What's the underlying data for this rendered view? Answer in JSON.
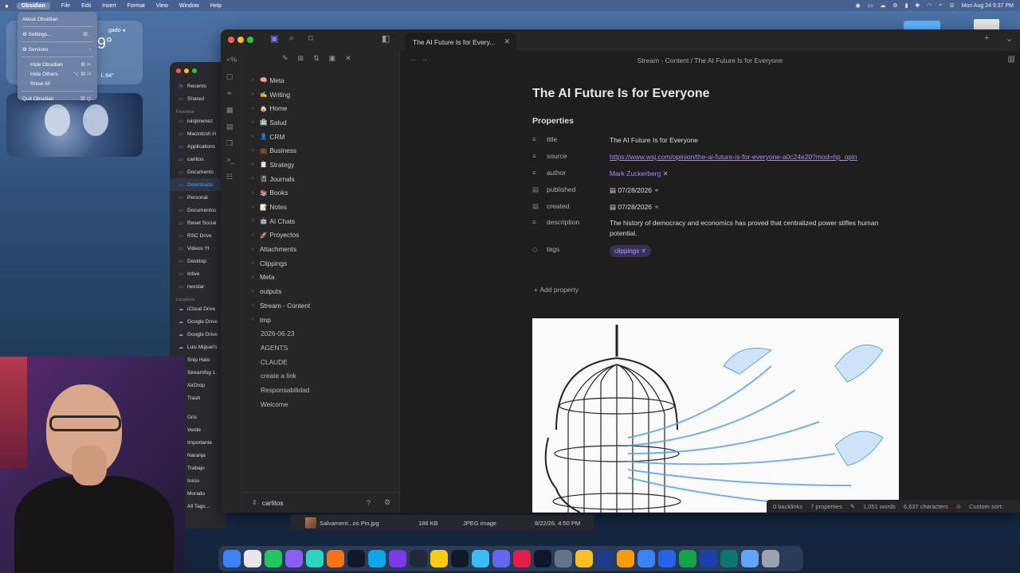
{
  "menubar": {
    "apple": "",
    "items": [
      "Obsidian",
      "File",
      "Edit",
      "Insert",
      "Format",
      "View",
      "Window",
      "Help"
    ],
    "clock": "Mon Aug 24  9:37 PM"
  },
  "app_menu": {
    "about": "About Obsidian",
    "settings": "Settings...",
    "settings_sc": "⌘ ,",
    "services": "Services",
    "hide": "Hide Obsidian",
    "hide_sc": "⌘ H",
    "hide_others": "Hide Others",
    "hide_others_sc": "⌥ ⌘ H",
    "show_all": "Show All",
    "quit": "Quit Obsidian",
    "quit_sc": "⌘ Q"
  },
  "weather": {
    "city": "gado ◂",
    "temp": "9°",
    "range": "L:64°",
    "row2": "y"
  },
  "finder": {
    "recents": "Recents",
    "shared": "Shared",
    "favorites_label": "Favorites",
    "favorites": [
      "luisjimenez",
      "Macintosh H",
      "Applications",
      "carlitos",
      "Documents",
      "Downloads",
      "Personal",
      "Documentos",
      "Reset Social",
      "RSC Drive",
      "Videos Yt",
      "Desktop",
      "Intive",
      "nexstar"
    ],
    "locations_label": "Locations",
    "locations": [
      "iCloud Drive",
      "Google Drive",
      "Google Drive",
      "Luis Miguel's",
      "Snip Halo",
      "Streamfog 1.",
      "AirDrop",
      "Trash"
    ],
    "tags": [
      "Gris",
      "Verde",
      "Importante",
      "Naranja",
      "Trabajo",
      "Inicio",
      "Morado",
      "All Tags..."
    ]
  },
  "obsidian": {
    "tab_title": "The AI Future Is for Every...",
    "breadcrumb": "Stream - Content  /  The AI Future Is for Everyone",
    "tree": [
      {
        "emoji": "🧠",
        "label": "Meta",
        "folder": true
      },
      {
        "emoji": "✍️",
        "label": "Writing",
        "folder": true
      },
      {
        "emoji": "🏠",
        "label": "Home",
        "folder": true
      },
      {
        "emoji": "🏥",
        "label": "Salud",
        "folder": true
      },
      {
        "emoji": "👤",
        "label": "CRM",
        "folder": true
      },
      {
        "emoji": "💼",
        "label": "Business",
        "folder": true
      },
      {
        "emoji": "📋",
        "label": "Strategy",
        "folder": true
      },
      {
        "emoji": "📓",
        "label": "Journals",
        "folder": true
      },
      {
        "emoji": "📚",
        "label": "Books",
        "folder": true
      },
      {
        "emoji": "📝",
        "label": "Notes",
        "folder": true
      },
      {
        "emoji": "🤖",
        "label": "AI Chats",
        "folder": true
      },
      {
        "emoji": "🚀",
        "label": "Proyectos",
        "folder": true
      },
      {
        "emoji": "",
        "label": "Attachments",
        "folder": true
      },
      {
        "emoji": "",
        "label": "Clippings",
        "folder": true
      },
      {
        "emoji": "",
        "label": "Meta",
        "folder": true
      },
      {
        "emoji": "",
        "label": "outputs",
        "folder": true
      },
      {
        "emoji": "",
        "label": "Stream - Content",
        "folder": true
      },
      {
        "emoji": "",
        "label": "tmp",
        "folder": true
      },
      {
        "emoji": "",
        "label": "2026-06-23",
        "folder": false
      },
      {
        "emoji": "",
        "label": "AGENTS",
        "folder": false
      },
      {
        "emoji": "",
        "label": "CLAUDE",
        "folder": false
      },
      {
        "emoji": "",
        "label": "create a link",
        "folder": false
      },
      {
        "emoji": "",
        "label": "Responsabilidad",
        "folder": false
      },
      {
        "emoji": "",
        "label": "Welcome",
        "folder": false
      }
    ],
    "vault_name": "carlitos",
    "note_title": "The AI Future Is for Everyone",
    "properties_heading": "Properties",
    "properties": {
      "title_key": "title",
      "title_val": "The AI Future Is for Everyone",
      "source_key": "source",
      "source_val": "https://www.wsj.com/opinion/the-ai-future-is-for-everyone-a0c24e20?mod=hp_opin",
      "author_key": "author",
      "author_val": "Mark Zuckerberg",
      "published_key": "published",
      "published_val": "07/28/2026",
      "created_key": "created",
      "created_val": "07/28/2026",
      "description_key": "description",
      "description_val": "The history of democracy and economics has proved that centralized power stifles human potential.",
      "tags_key": "tags",
      "tags_val": "clippings"
    },
    "add_property": "Add property",
    "status": {
      "backlinks": "0 backlinks",
      "properties": "7 properties",
      "words": "1,051 words",
      "chars": "6,637 characters",
      "sort": "Custom sort:"
    }
  },
  "file_strip": {
    "name": "Salvament...os Pin.jpg",
    "size": "188 KB",
    "kind": "JPEG image",
    "date": "8/22/26, 4:50 PM"
  },
  "colors": {
    "accent": "#a88bff",
    "tag_bg": "#3a2f57",
    "bg": "#1e1e1e"
  }
}
